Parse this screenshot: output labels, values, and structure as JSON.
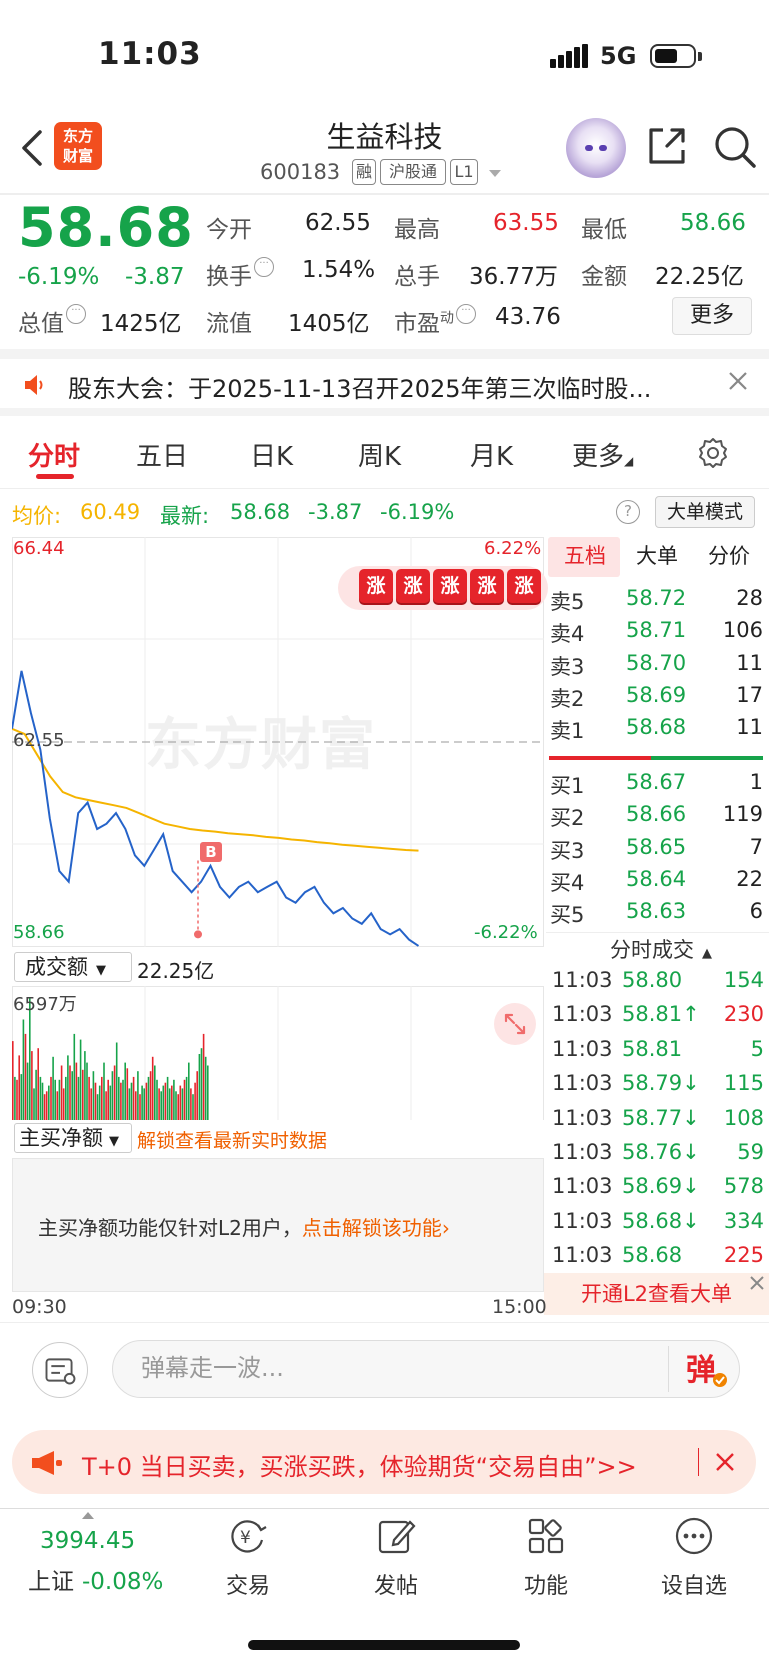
{
  "status": {
    "time": "11:03",
    "network": "5G"
  },
  "header": {
    "logo_line1": "东方",
    "logo_line2": "财富",
    "stock_name": "生益科技",
    "stock_code": "600183",
    "tags": [
      "融",
      "沪股通",
      "L1"
    ]
  },
  "quote": {
    "price": "58.68",
    "change_pct": "-6.19%",
    "change": "-3.87",
    "open_label": "今开",
    "open": "62.55",
    "high_label": "最高",
    "high": "63.55",
    "low_label": "最低",
    "low": "58.66",
    "turnover_label": "换手",
    "turnover": "1.54%",
    "volume_label": "总手",
    "volume": "36.77万",
    "amount_label": "金额",
    "amount": "22.25亿",
    "mktcap_label": "总值",
    "mktcap": "1425亿",
    "float_label": "流值",
    "float_cap": "1405亿",
    "pe_label": "市盈",
    "pe_sup": "动",
    "pe": "43.76",
    "more": "更多"
  },
  "notice": {
    "text": "股东大会：于2025-11-13召开2025年第三次临时股..."
  },
  "tabs": [
    {
      "label": "分时"
    },
    {
      "label": "五日"
    },
    {
      "label": "日K"
    },
    {
      "label": "周K"
    },
    {
      "label": "月K"
    },
    {
      "label": "更多"
    }
  ],
  "chart_info": {
    "avg_label": "均价:",
    "avg": "60.49",
    "latest_label": "最新:",
    "latest": "58.68",
    "latest_chg": "-3.87",
    "latest_pct": "-6.19%",
    "help": "?",
    "mode": "大单模式"
  },
  "chart_labels": {
    "y_top": "66.44",
    "y_mid": "62.55",
    "y_bottom": "58.66",
    "pct_top": "6.22%",
    "pct_bottom": "-6.22%",
    "zhang": "涨",
    "watermark": "东方财富",
    "buy_mark": "B",
    "vol_selector": "成交额",
    "vol_total": "22.25亿",
    "vol_max": "6597万",
    "net_selector": "主买净额",
    "unlock_link": "解锁查看最新实时数据",
    "lock_text": "主买净额功能仅针对L2用户，",
    "lock_action": "点击解锁该功能",
    "time_start": "09:30",
    "time_end": "15:00"
  },
  "chart_data": {
    "type": "line",
    "y_range": [
      58.66,
      66.44
    ],
    "prev_close": 62.55,
    "series": [
      {
        "name": "最新",
        "values": [
          62.8,
          63.9,
          63.1,
          62.4,
          61.1,
          60.1,
          59.9,
          61.2,
          61.4,
          60.9,
          61.0,
          61.2,
          60.9,
          60.4,
          60.2,
          60.5,
          60.8,
          60.1,
          59.9,
          59.7,
          59.9,
          60.2,
          59.8,
          59.6,
          59.8,
          59.9,
          59.7,
          59.8,
          59.9,
          59.6,
          59.5,
          59.7,
          59.8,
          59.5,
          59.3,
          59.4,
          59.2,
          59.1,
          59.3,
          59.0,
          58.9,
          59.0,
          58.8,
          58.68
        ]
      },
      {
        "name": "均价",
        "values": [
          62.8,
          62.7,
          62.3,
          61.9,
          61.6,
          61.5,
          61.45,
          61.4,
          61.35,
          61.3,
          61.2,
          61.1,
          61.0,
          60.95,
          60.9,
          60.87,
          60.85,
          60.82,
          60.8,
          60.78,
          60.75,
          60.73,
          60.7,
          60.68,
          60.65,
          60.63,
          60.6,
          60.58,
          60.56,
          60.54,
          60.52,
          60.5,
          60.49
        ]
      }
    ]
  },
  "volume_data": [
    55,
    30,
    28,
    45,
    32,
    70,
    60,
    40,
    85,
    48,
    22,
    35,
    50,
    30,
    26,
    18,
    20,
    24,
    30,
    44,
    28,
    20,
    28,
    38,
    22,
    30,
    45,
    38,
    34,
    60,
    40,
    30,
    56,
    35,
    48,
    40,
    30,
    22,
    34,
    26,
    18,
    24,
    30,
    40,
    20,
    28,
    24,
    34,
    38,
    54,
    30,
    26,
    28,
    40,
    36,
    22,
    26,
    30,
    20,
    34,
    18,
    24,
    22,
    26,
    30,
    34,
    44,
    38,
    28,
    22,
    20,
    24,
    26,
    30,
    22,
    24,
    28,
    20,
    18,
    24,
    22,
    28,
    30,
    40,
    22,
    18,
    26,
    34,
    46,
    50,
    60,
    44,
    38
  ],
  "order_book": {
    "tabs": [
      "五档",
      "大单",
      "分价"
    ],
    "sells": [
      {
        "label": "卖5",
        "price": "58.72",
        "vol": "28"
      },
      {
        "label": "卖4",
        "price": "58.71",
        "vol": "106"
      },
      {
        "label": "卖3",
        "price": "58.70",
        "vol": "11"
      },
      {
        "label": "卖2",
        "price": "58.69",
        "vol": "17"
      },
      {
        "label": "卖1",
        "price": "58.68",
        "vol": "11"
      }
    ],
    "buys": [
      {
        "label": "买1",
        "price": "58.67",
        "vol": "1"
      },
      {
        "label": "买2",
        "price": "58.66",
        "vol": "119"
      },
      {
        "label": "买3",
        "price": "58.65",
        "vol": "7"
      },
      {
        "label": "买4",
        "price": "58.64",
        "vol": "22"
      },
      {
        "label": "买5",
        "price": "58.63",
        "vol": "6"
      }
    ],
    "deals_title": "分时成交",
    "deals": [
      {
        "time": "11:03",
        "price": "58.80",
        "vol": "154",
        "arrow": "",
        "vol_color": "#16a34a"
      },
      {
        "time": "11:03",
        "price": "58.81↑",
        "vol": "230",
        "arrow": "",
        "vol_color": "#e5242b"
      },
      {
        "time": "11:03",
        "price": "58.81",
        "vol": "5",
        "arrow": "",
        "vol_color": "#16a34a"
      },
      {
        "time": "11:03",
        "price": "58.79↓",
        "vol": "115",
        "arrow": "",
        "vol_color": "#16a34a"
      },
      {
        "time": "11:03",
        "price": "58.77↓",
        "vol": "108",
        "arrow": "",
        "vol_color": "#16a34a"
      },
      {
        "time": "11:03",
        "price": "58.76↓",
        "vol": "59",
        "arrow": "",
        "vol_color": "#16a34a"
      },
      {
        "time": "11:03",
        "price": "58.69↓",
        "vol": "578",
        "arrow": "",
        "vol_color": "#16a34a"
      },
      {
        "time": "11:03",
        "price": "58.68↓",
        "vol": "334",
        "arrow": "",
        "vol_color": "#16a34a"
      },
      {
        "time": "11:03",
        "price": "58.68",
        "vol": "225",
        "arrow": "",
        "vol_color": "#e5242b"
      }
    ],
    "l2_banner": "开通L2查看大单"
  },
  "danmu": {
    "placeholder": "弹幕走一波..."
  },
  "ad": {
    "text": "T+0 当日买卖，买涨买跌，体验期货“交易自由”>>"
  },
  "bottom_nav": {
    "index_value": "3994.45",
    "index_name": "上证",
    "index_chg": "-0.08%",
    "items": [
      {
        "label": "交易"
      },
      {
        "label": "发帖"
      },
      {
        "label": "功能"
      },
      {
        "label": "设自选"
      }
    ]
  },
  "colors": {
    "up": "#e5242b",
    "down": "#16a34a",
    "avg": "#f5b400",
    "price_line": "#2563c9"
  }
}
